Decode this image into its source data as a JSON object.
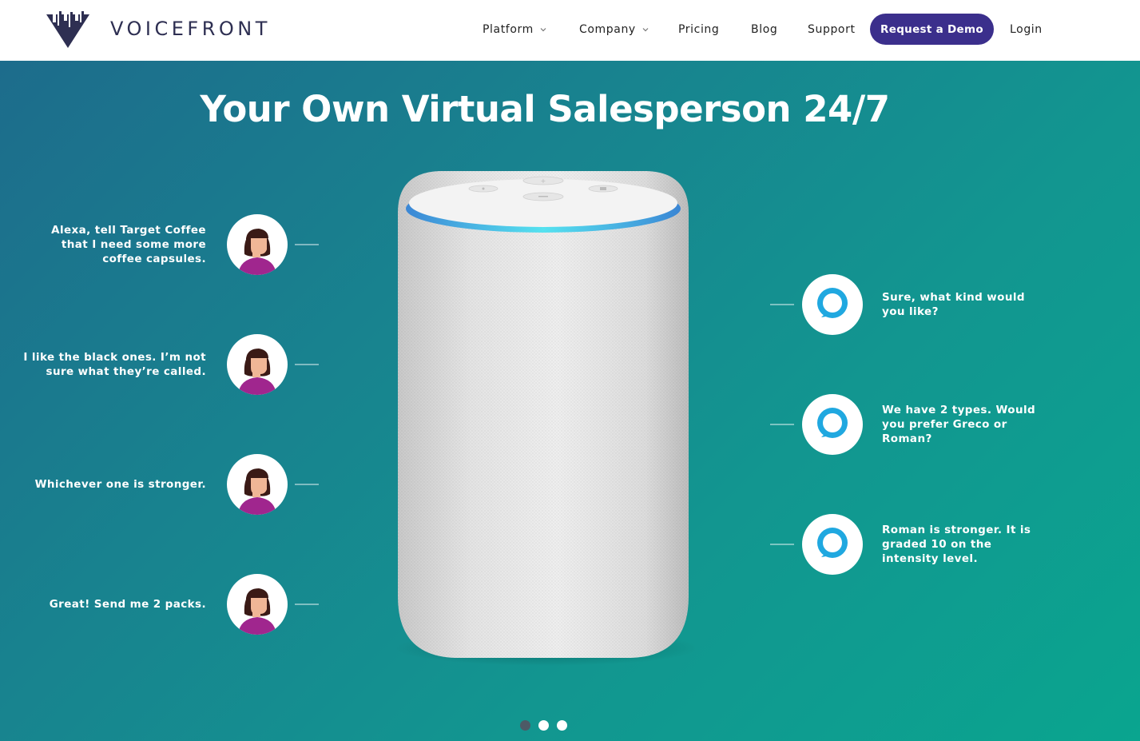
{
  "header": {
    "brand": "VOICEFRONT",
    "nav": {
      "platform": "Platform",
      "company": "Company",
      "pricing": "Pricing",
      "blog": "Blog",
      "support": "Support",
      "demo": "Request a Demo",
      "login": "Login"
    }
  },
  "hero": {
    "title": "Your Own Virtual Salesperson 24/7",
    "user_messages": [
      "Alexa, tell Target Coffee that I need some more coffee capsules.",
      "I like the black ones. I’m not sure what they’re called.",
      "Whichever one is stronger.",
      "Great! Send me 2 packs."
    ],
    "alexa_messages": [
      "Sure, what kind would you like?",
      "We have 2 types. Would you prefer Greco or Roman?",
      "Roman is stronger. It is graded 10 on the intensity level."
    ],
    "carousel": {
      "total": 3,
      "active": 1
    }
  },
  "colors": {
    "brand_dark": "#2e2f52",
    "button_purple": "#3b2f8c",
    "hero_gradient_start": "#1d6c8c",
    "hero_gradient_end": "#0aa58f",
    "alexa_blue": "#20a8e0",
    "avatar_shirt": "#a0268e"
  },
  "icons": {
    "logo": "voicefront-logo-icon",
    "nav_dropdown": "chevron-down-icon",
    "user": "woman-avatar-icon",
    "assistant": "alexa-icon"
  }
}
